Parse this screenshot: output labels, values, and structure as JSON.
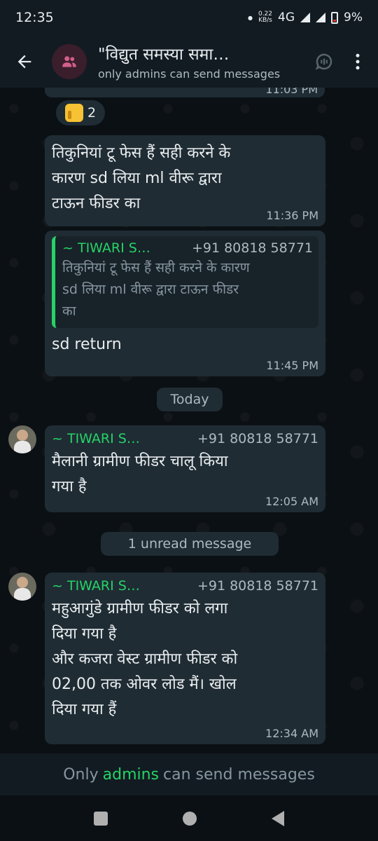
{
  "status_bar": {
    "time": "12:35",
    "speed_value": "0.22",
    "speed_unit": "KB/s",
    "network": "4G",
    "battery": "9%"
  },
  "header": {
    "title": "\"विद्युत समस्या समा…",
    "subtitle": "only admins can send messages"
  },
  "messages": {
    "partial_time": "11:03 PM",
    "reaction": {
      "emoji": "thumbs-up",
      "count": "2"
    },
    "m1": {
      "text": "तिकुनियां टू फेस हैं सही करने के\nकारण sd लिया ml वीरू द्वारा\nटाऊन फीडर का",
      "time": "11:36 PM"
    },
    "m2": {
      "quote_sender": "~ TIWARI S…",
      "quote_phone": "+91 80818 58771",
      "quote_text": "तिकुनियां टू फेस हैं सही करने के कारण\nsd लिया ml वीरू द्वारा  टाऊन फीडर\nका",
      "text": "sd return",
      "time": "11:45 PM"
    },
    "date_divider": "Today",
    "m3": {
      "sender": "~ TIWARI S…",
      "phone": "+91 80818 58771",
      "text": "मैलानी ग्रामीण फीडर चालू किया\nगया है",
      "time": "12:05 AM"
    },
    "unread_divider": "1 unread message",
    "m4": {
      "sender": "~ TIWARI S…",
      "phone": "+91 80818 58771",
      "text": "महुआगुंडे ग्रामीण फीडर को लगा\nदिया गया है\nऔर कजरा वेस्ट ग्रामीण फीडर को\n02,00 तक ओवर लोड मैं। खोल\nदिया गया हैं",
      "time": "12:34 AM"
    }
  },
  "footer": {
    "prefix": "Only",
    "link": "admins",
    "suffix": "can send messages"
  },
  "colors": {
    "accent": "#25d366",
    "bubble": "#1f2c34",
    "bar": "#121b22"
  }
}
